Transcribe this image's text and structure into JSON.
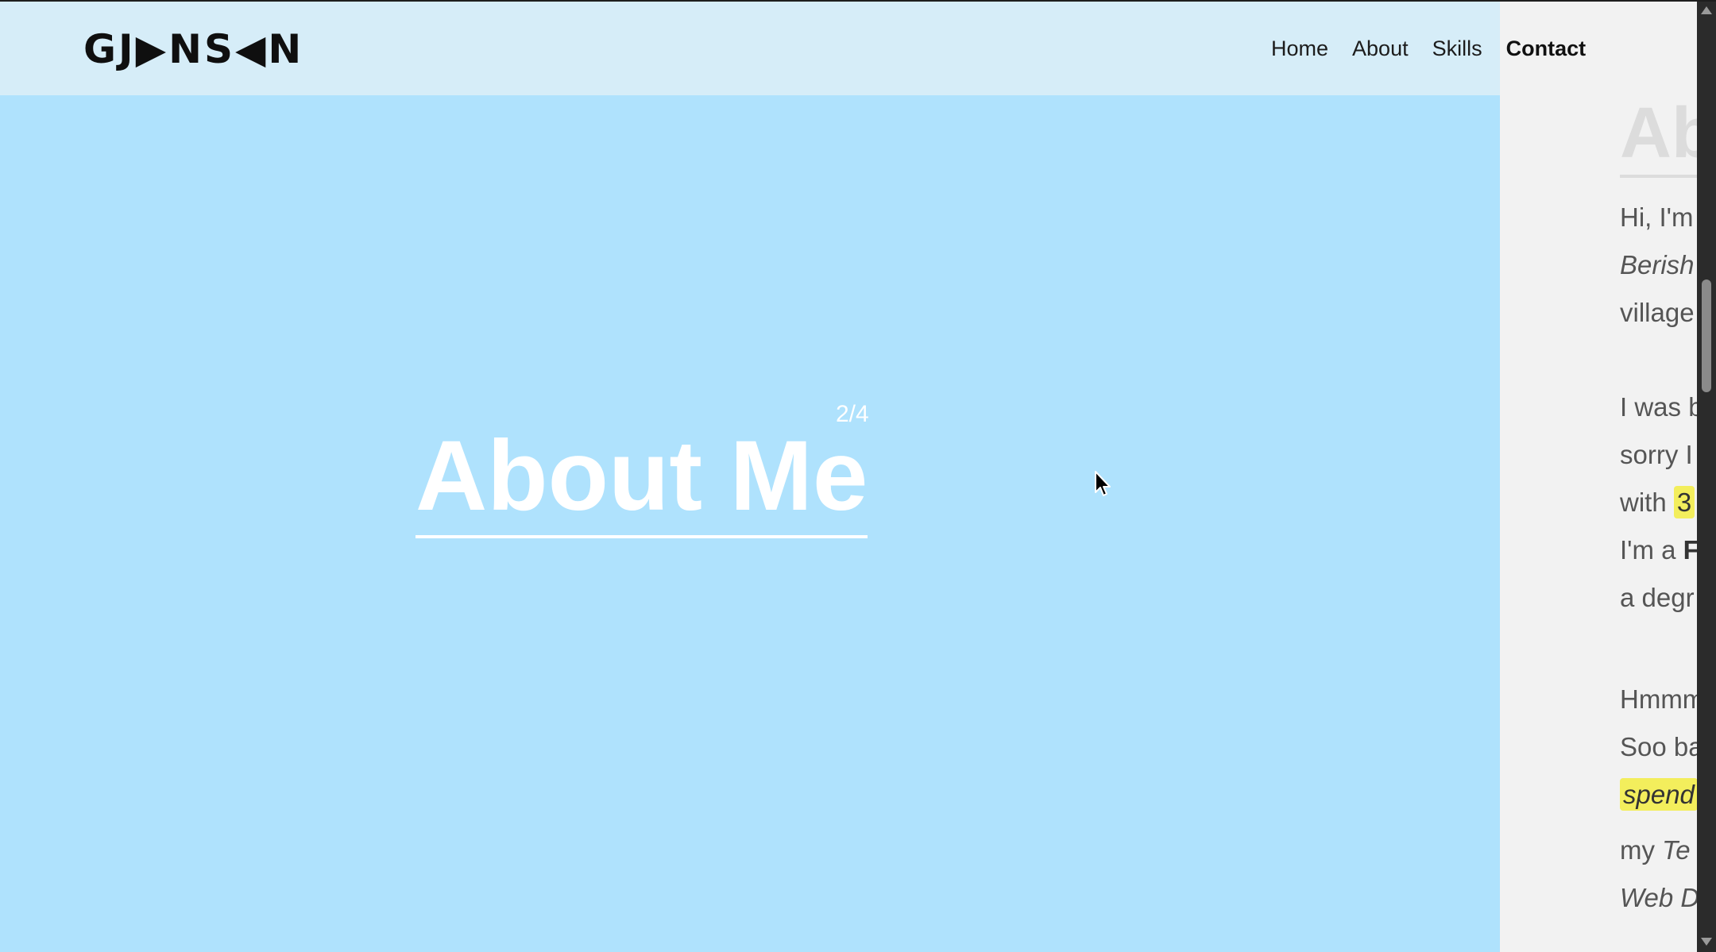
{
  "header": {
    "logo_text": "GJ▶NS◀N",
    "nav": {
      "home": "Home",
      "about": "About",
      "skills": "Skills",
      "contact": "Contact"
    }
  },
  "hero": {
    "counter": "2/4",
    "title": "About Me"
  },
  "side": {
    "heading": "Ab",
    "lines": {
      "l1": "Hi, I'm",
      "l2": "Berish",
      "l3": "village",
      "l4": "I was b",
      "l5": "sorry I",
      "l6_prefix": "with ",
      "l6_hl": "3",
      "l7_prefix": "I'm a ",
      "l7_bold": "F",
      "l8": "a degr",
      "l9": "Hmmm",
      "l10": "Soo ba",
      "l11_hl": "spend",
      "l12_prefix": "my ",
      "l12_italic": "Te",
      "l13": "Web D"
    }
  },
  "colors": {
    "hero_bg": "#afe2fd",
    "header_bg": "#d6edf8",
    "side_bg": "#f2f2f2",
    "highlight": "#f3ee5c"
  }
}
